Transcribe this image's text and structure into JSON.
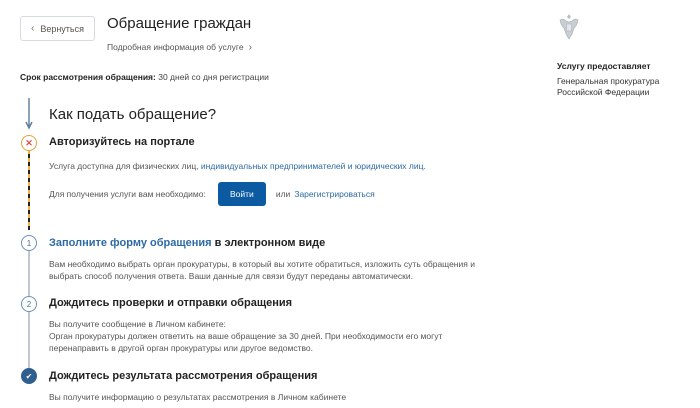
{
  "header": {
    "back_label": "Вернуться",
    "title": "Обращение граждан",
    "subtitle": "Подробная информация об услуге"
  },
  "deadline": {
    "label": "Срок рассмотрения обращения:",
    "value": "30 дней со дня регистрации"
  },
  "provider": {
    "heading": "Услугу предоставляет",
    "name_line1": "Генеральная прокуратура",
    "name_line2": "Российской Федерации"
  },
  "how": {
    "title": "Как подать обращение?"
  },
  "steps": {
    "auth": {
      "marker": "✕",
      "heading": "Авторизуйтесь на портале",
      "text_before": "Услуга доступна для физических лиц,",
      "link_text": "индивидуальных предпринимателей и юридических лиц",
      "text_after": ".",
      "login_prompt": "Для получения услуги вам необходимо:",
      "login_button": "Войти",
      "or_text": "или",
      "register_link": "Зарегистрироваться"
    },
    "fill": {
      "number": "1",
      "heading_link": "Заполните форму обращения",
      "heading_rest": "в электронном виде",
      "line1": "Вам необходимо выбрать орган прокуратуры, в который вы хотите обратиться, изложить суть обращения и",
      "line2": "выбрать способ получения ответа. Ваши данные для связи будут переданы автоматически."
    },
    "wait": {
      "number": "2",
      "heading": "Дождитесь проверки и отправки обращения",
      "line1": "Вы получите сообщение в Личном кабинете:",
      "line2": "Орган прокуратуры должен ответить на ваше обращение за 30 дней. При необходимости его могут",
      "line3": "перенаправить в другой орган прокуратуры или другое ведомство."
    },
    "result": {
      "marker": "✔",
      "heading": "Дождитесь результата рассмотрения обращения",
      "line1": "Вы получите информацию о результатах рассмотрения в Личном кабинете"
    }
  }
}
